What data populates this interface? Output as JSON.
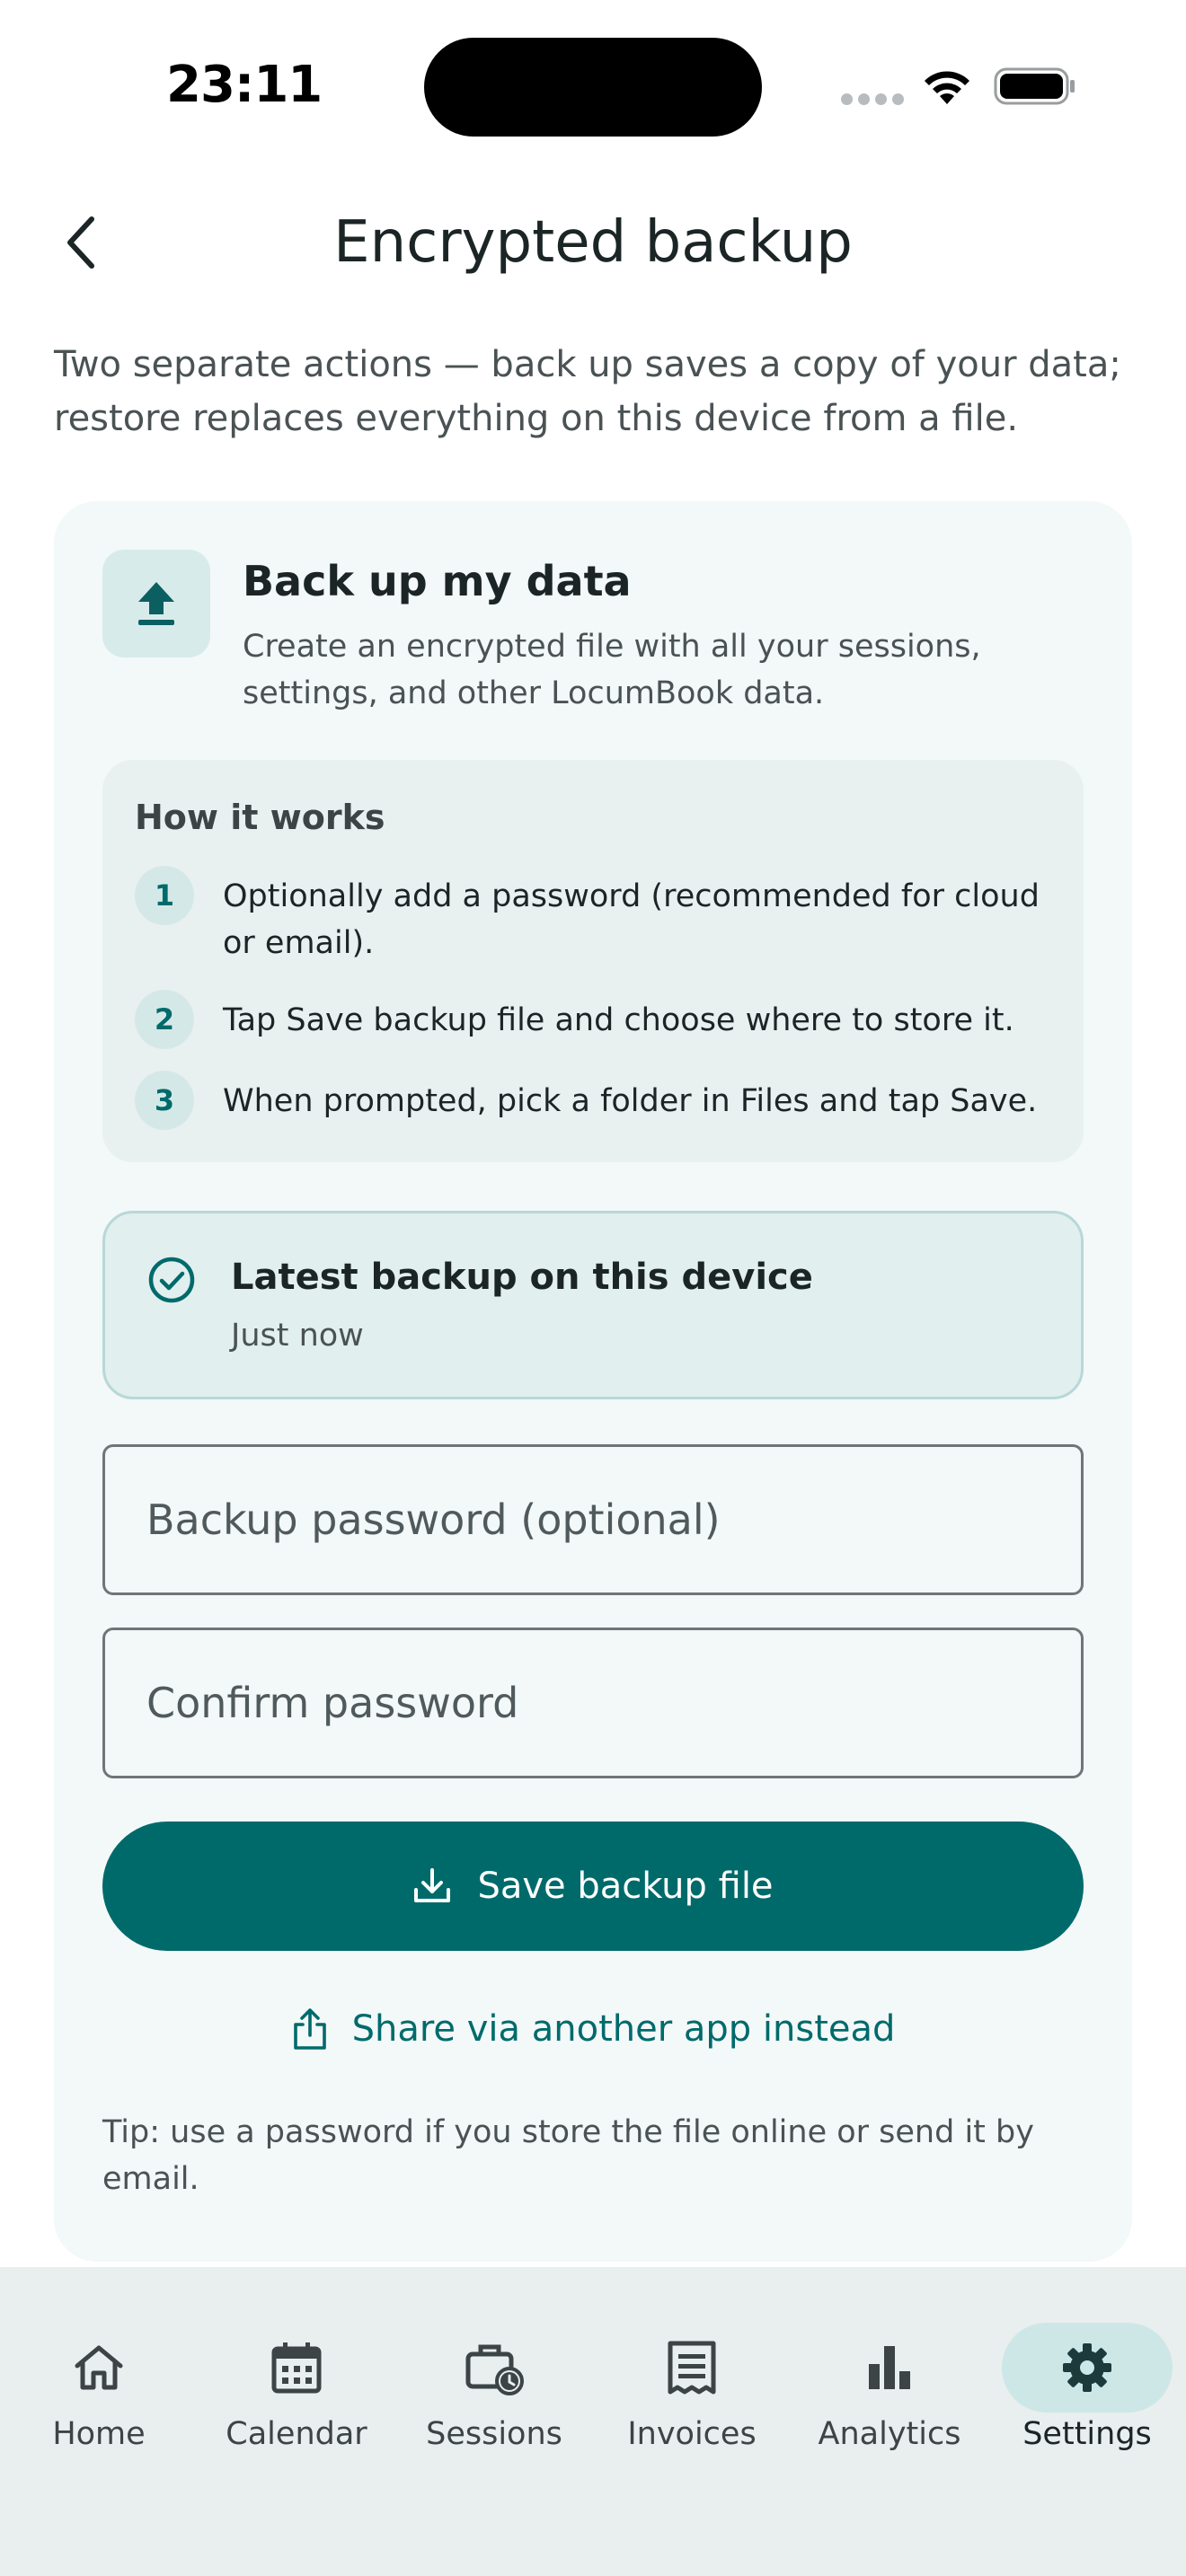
{
  "status": {
    "time": "23:11"
  },
  "header": {
    "title": "Encrypted backup"
  },
  "intro": "Two separate actions — back up saves a copy of your data; restore replaces everything on this device from a file.",
  "backup_card": {
    "title": "Back up my data",
    "description": "Create an encrypted file with all your sessions, settings, and other LocumBook data.",
    "how_it_works": {
      "title": "How it works",
      "steps": [
        {
          "num": "1",
          "text": "Optionally add a password (recommended for cloud or email)."
        },
        {
          "num": "2",
          "text": "Tap Save backup file and choose where to store it."
        },
        {
          "num": "3",
          "text": "When prompted, pick a folder in Files and tap Save."
        }
      ]
    },
    "latest": {
      "title": "Latest backup on this device",
      "value": "Just now"
    },
    "password_placeholder": "Backup password (optional)",
    "confirm_placeholder": "Confirm password",
    "save_label": "Save backup file",
    "share_label": "Share via another app instead",
    "tip": "Tip: use a password if you store the file online or send it by email."
  },
  "tabs": [
    {
      "label": "Home",
      "icon": "home-icon"
    },
    {
      "label": "Calendar",
      "icon": "calendar-icon"
    },
    {
      "label": "Sessions",
      "icon": "briefcase-clock-icon"
    },
    {
      "label": "Invoices",
      "icon": "receipt-icon"
    },
    {
      "label": "Analytics",
      "icon": "bar-chart-icon"
    },
    {
      "label": "Settings",
      "icon": "gear-icon",
      "active": true
    }
  ],
  "colors": {
    "accent": "#006a6b",
    "card": "#f3f8f8",
    "tab_bar": "#e9eeef"
  }
}
